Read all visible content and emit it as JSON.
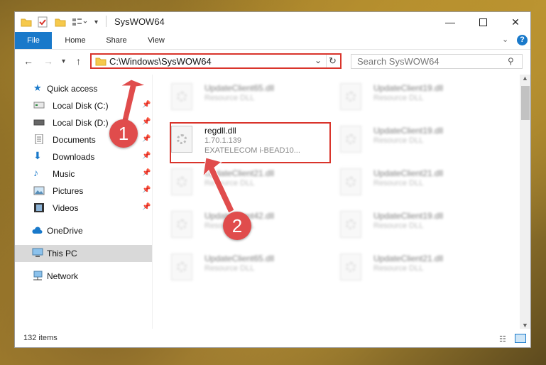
{
  "window": {
    "title": "SysWOW64"
  },
  "ribbon": {
    "tabs": [
      "File",
      "Home",
      "Share",
      "View"
    ]
  },
  "nav": {
    "address": "C:\\Windows\\SysWOW64",
    "search_placeholder": "Search SysWOW64"
  },
  "sidebar": {
    "items": [
      {
        "label": "Quick access",
        "icon": "star-icon"
      },
      {
        "label": "Local Disk (C:)",
        "icon": "drive-icon"
      },
      {
        "label": "Local Disk (D:)",
        "icon": "drive-icon"
      },
      {
        "label": "Documents",
        "icon": "documents-icon"
      },
      {
        "label": "Downloads",
        "icon": "download-icon"
      },
      {
        "label": "Music",
        "icon": "music-icon"
      },
      {
        "label": "Pictures",
        "icon": "pictures-icon"
      },
      {
        "label": "Videos",
        "icon": "video-icon"
      },
      {
        "label": "OneDrive",
        "icon": "cloud-icon"
      },
      {
        "label": "This PC",
        "icon": "computer-icon"
      },
      {
        "label": "Network",
        "icon": "network-icon"
      }
    ]
  },
  "files": [
    {
      "name": "UpdateClient65.dll",
      "type": "Resource DLL"
    },
    {
      "name": "UpdateClient19.dll",
      "type": "Resource DLL"
    },
    {
      "name": "regdll.dll",
      "version": "1.70.1.139",
      "company": "EXATELECOM i-BEAD10..."
    },
    {
      "name": "UpdateClient19.dll",
      "type": "Resource DLL"
    },
    {
      "name": "UpdateClient21.dll",
      "type": "Resource DLL"
    },
    {
      "name": "UpdateClient21.dll",
      "type": "Resource DLL"
    },
    {
      "name": "UpdateClient42.dll",
      "type": "Resource DLL"
    },
    {
      "name": "UpdateClient19.dll",
      "type": "Resource DLL"
    },
    {
      "name": "UpdateClient65.dll",
      "type": "Resource DLL"
    },
    {
      "name": "UpdateClient21.dll",
      "type": "Resource DLL"
    }
  ],
  "status": {
    "items": "132 items"
  },
  "annotations": {
    "badge1": "1",
    "badge2": "2"
  },
  "colors": {
    "accent": "#1979ca",
    "highlight": "#d9342b"
  }
}
